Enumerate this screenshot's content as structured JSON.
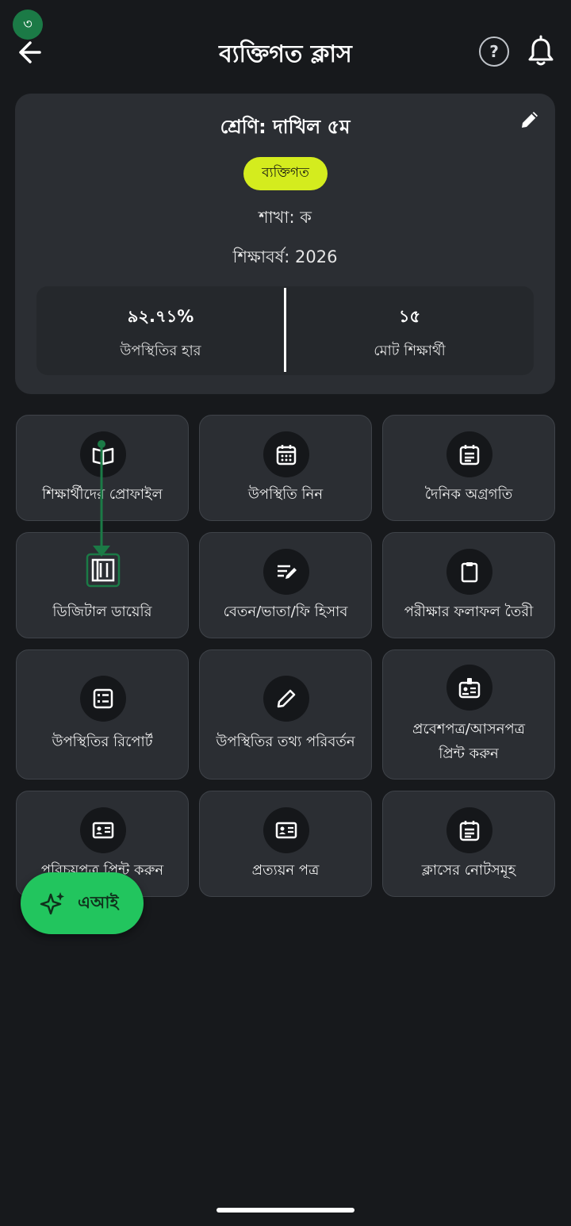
{
  "status": {
    "step_badge": "৩"
  },
  "header": {
    "title": "ব্যক্তিগত ক্লাস",
    "help_label": "?"
  },
  "class_info": {
    "title": "শ্রেণি: দাখিল ৫ম",
    "type_badge": "ব্যক্তিগত",
    "section": "শাখা: ক",
    "academic_year": "শিক্ষাবর্ষ: 2026",
    "stats": [
      {
        "value": "৯২.৭১%",
        "label": "উপস্থিতির হার"
      },
      {
        "value": "১৫",
        "label": "মোট শিক্ষার্থী"
      }
    ]
  },
  "actions": [
    {
      "label": "শিক্ষার্থীদের প্রোফাইল",
      "icon": "book-open-icon"
    },
    {
      "label": "উপস্থিতি নিন",
      "icon": "calendar-icon"
    },
    {
      "label": "দৈনিক অগ্রগতি",
      "icon": "calendar-list-icon"
    },
    {
      "label": "ডিজিটাল ডায়েরি",
      "icon": "diary-icon"
    },
    {
      "label": "বেতন/ভাতা/ফি হিসাব",
      "icon": "edit-note-icon"
    },
    {
      "label": "পরীক্ষার ফলাফল তৈরী",
      "icon": "clipboard-icon"
    },
    {
      "label": "উপস্থিতির রিপোর্ট",
      "icon": "list-report-icon"
    },
    {
      "label": "উপস্থিতির তথ্য পরিবর্তন",
      "icon": "pencil-icon"
    },
    {
      "label_line1": "প্রবেশপত্র/আসনপত্র",
      "label_line2": "প্রিন্ট করুন",
      "icon": "id-badge-icon"
    },
    {
      "label": "পরিচয়পত্র প্রিন্ট করুন",
      "icon": "id-card-icon"
    },
    {
      "label": "প্রত্যয়ন পত্র",
      "icon": "certificate-icon"
    },
    {
      "label": "ক্লাসের নোটসমূহ",
      "icon": "notes-icon"
    }
  ],
  "fab": {
    "label": "এআই",
    "icon": "sparkle-icon"
  },
  "colors": {
    "background": "#17191c",
    "card": "#2b2e33",
    "badge": "#d4ec1e",
    "accent_green": "#22c55e",
    "annotation_green": "#1b7a46"
  }
}
